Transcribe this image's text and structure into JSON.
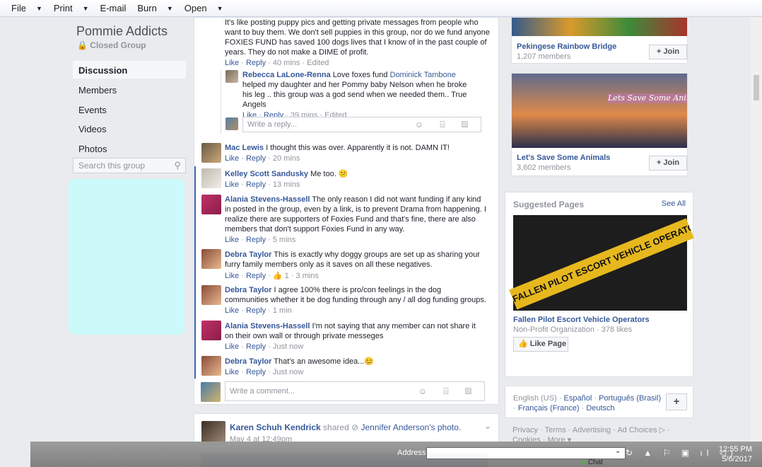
{
  "menubar": {
    "items": [
      {
        "label": "File",
        "arrow": true
      },
      {
        "label": "Print",
        "arrow": true
      },
      {
        "label": "E-mail",
        "arrow": false
      },
      {
        "label": "Burn",
        "arrow": true
      },
      {
        "label": "Open",
        "arrow": true
      }
    ]
  },
  "group": {
    "title": "Pommie Addicts",
    "privacy": "Closed Group",
    "nav": [
      "Discussion",
      "Members",
      "Events",
      "Videos",
      "Photos"
    ],
    "search_placeholder": "Search this group"
  },
  "post": {
    "top_text": "It's like posting puppy pics and getting private messages from people who want to buy them. We don't sell puppies in this group, nor do we fund anyone FOXIES FUND has saved 100 dogs lives that I know of in the past couple of years. They do not make a DIME of profit.",
    "top_actions": {
      "like": "Like",
      "reply": "Reply",
      "meta": "40 mins · Edited"
    },
    "reply": {
      "name": "Rebecca LaLone-Renna",
      "text_before": "Love foxes fund",
      "mention": "Dominick Tambone",
      "text_after": "helped my daughter and her Pommy baby Nelson when he broke his leg .. this group was a god send when we needed them.. True Angels",
      "like": "Like",
      "reply_label": "Reply",
      "meta": "39 mins · Edited"
    },
    "write_reply_placeholder": "Write a reply...",
    "comments": [
      {
        "name": "Mac Lewis",
        "text": "I thought this was over. Apparently it is not. DAMN IT!",
        "like": "Like",
        "reply": "Reply",
        "meta": "20 mins"
      },
      {
        "name": "Kelley Scott Sandusky",
        "text": "Me too. 😕",
        "like": "Like",
        "reply": "Reply",
        "meta": "13 mins"
      },
      {
        "name": "Alania Stevens-Hassell",
        "text": "The only reason I did not want funding if any kind in posted in the group, even by a link, is to prevent Drama from happening. I realize there are supporters of Foxies Fund and that's fine, there are also members that don't support Foxies Fund in any way.",
        "like": "Like",
        "reply": "Reply",
        "meta": "5 mins"
      },
      {
        "name": "Debra Taylor",
        "text": "This is exactly why doggy groups are set up as sharing your furry family members only as it saves on all these negatives.",
        "like": "Like",
        "reply": "Reply",
        "meta": "1 · 3 mins"
      },
      {
        "name": "Debra Taylor",
        "text": "I agree 100% there is pro/con feelings in the dog communities whether it be dog funding through any / all dog funding groups.",
        "like": "Like",
        "reply": "Reply",
        "meta": "1 min"
      },
      {
        "name": "Alania Stevens-Hassell",
        "text": "I'm not saying that any member can not share it on their own wall or through private messeges",
        "like": "Like",
        "reply": "Reply",
        "meta": "Just now"
      },
      {
        "name": "Debra Taylor",
        "text": "That's an awesome idea...😊",
        "like": "Like",
        "reply": "Reply",
        "meta": "Just now"
      }
    ],
    "write_comment_placeholder": "Write a comment..."
  },
  "next_post": {
    "author": "Karen Schuh Kendrick",
    "shared": "shared",
    "target": "Jennifer Anderson's",
    "object": "photo.",
    "time": "May 4 at 12:49pm"
  },
  "right": {
    "groups": [
      {
        "name": "Pekingese Rainbow Bridge",
        "count": "1,207 members",
        "join": "+ Join"
      },
      {
        "name": "Let's Save Some Animals",
        "count": "3,602 members",
        "join": "+ Join",
        "banner_text": "Lets Save Some Anim"
      }
    ],
    "suggested": {
      "title": "Suggested Pages",
      "see_all": "See All",
      "page_name": "Fallen Pilot Escort Vehicle Operators",
      "page_meta": "Non-Profit Organization · 378 likes",
      "like_btn": "Like Page",
      "image_text": "FALLEN PILOT ESCORT VEHICLE OPERATORS"
    },
    "languages": {
      "current": "English (US) ·",
      "links": [
        "Español",
        "Português (Brasil)",
        "Français (France)",
        "Deutsch"
      ],
      "add": "+"
    },
    "footer": "Privacy · Terms · Advertising · Ad Choices ▷ ·",
    "footer2": "Cookies · More ▾",
    "chat": "Chat"
  },
  "taskbar": {
    "address_label": "Address",
    "time": "12:55 PM",
    "date": "5/6/2017"
  }
}
